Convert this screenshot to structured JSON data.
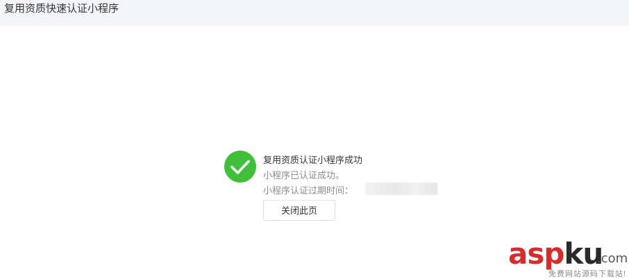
{
  "header": {
    "title": "复用资质快速认证小程序"
  },
  "result": {
    "icon": "check-circle-icon",
    "icon_color": "#3fbf3a",
    "title": "复用资质认证小程序成功",
    "description": "小程序已认证成功。",
    "expire_label": "小程序认证过期时间：",
    "close_button_label": "关闭此页"
  },
  "watermark": {
    "brand_part1": "asp",
    "brand_part2": "ku",
    "domain_suffix": ".com",
    "tagline": "免费网站源码下载站!"
  }
}
